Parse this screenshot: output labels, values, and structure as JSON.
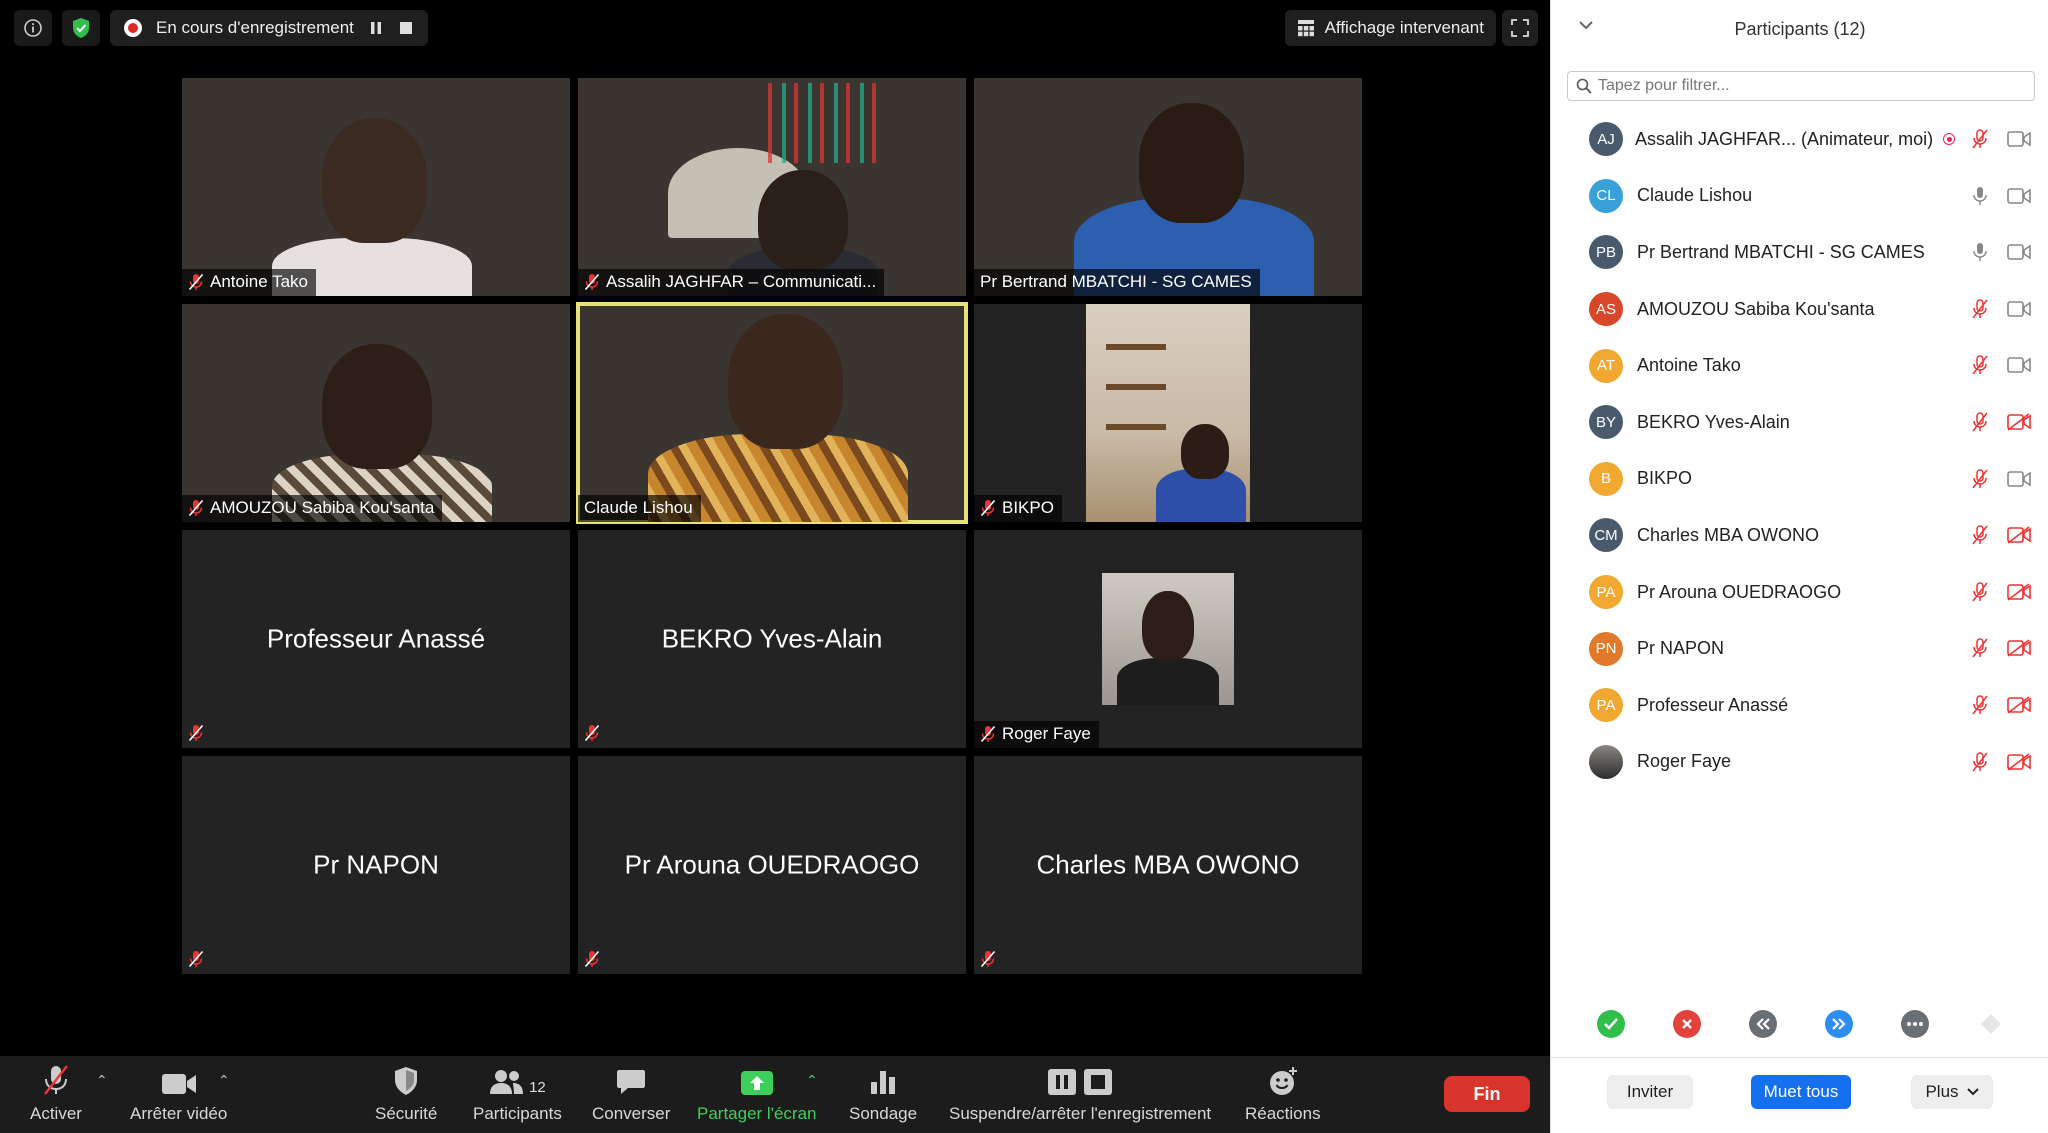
{
  "topbar": {
    "recording_label": "En cours d'enregistrement",
    "view_label": "Affichage intervenant"
  },
  "tiles": [
    {
      "name": "Antoine Tako",
      "type": "video",
      "muted": true
    },
    {
      "name": "Assalih JAGHFAR – Communicati...",
      "type": "video",
      "muted": true
    },
    {
      "name": "Pr Bertrand MBATCHI - SG CAMES",
      "type": "video",
      "muted": false
    },
    {
      "name": "AMOUZOU Sabiba Kou'santa",
      "type": "video",
      "muted": true
    },
    {
      "name": "Claude Lishou",
      "type": "video",
      "muted": false,
      "active": true
    },
    {
      "name": "BIKPO",
      "type": "video",
      "muted": true
    },
    {
      "name": "Professeur Anassé",
      "type": "name",
      "muted": true
    },
    {
      "name": "BEKRO Yves-Alain",
      "type": "name",
      "muted": true
    },
    {
      "name": "Roger Faye",
      "type": "photo",
      "muted": true
    },
    {
      "name": "Pr NAPON",
      "type": "name",
      "muted": true
    },
    {
      "name": "Pr Arouna OUEDRAOGO",
      "type": "name",
      "muted": true
    },
    {
      "name": "Charles MBA OWONO",
      "type": "name",
      "muted": true
    }
  ],
  "toolbar": {
    "unmute": "Activer",
    "stop_video": "Arrêter vidéo",
    "security": "Sécurité",
    "participants": "Participants",
    "participants_count": "12",
    "chat": "Converser",
    "share": "Partager l'écran",
    "poll": "Sondage",
    "recording": "Suspendre/arrêter l'enregistrement",
    "reactions": "Réactions",
    "end": "Fin"
  },
  "panel": {
    "title": "Participants (12)",
    "filter_placeholder": "Tapez pour filtrer...",
    "participants": [
      {
        "initials": "AJ",
        "name": "Assalih JAGHFAR... (Animateur, moi)",
        "color": "#4a5a6d",
        "mic": "off",
        "cam": "on",
        "host": true
      },
      {
        "initials": "CL",
        "name": "Claude Lishou",
        "color": "#3aa0d8",
        "mic": "on",
        "cam": "on"
      },
      {
        "initials": "PB",
        "name": "Pr Bertrand MBATCHI - SG CAMES",
        "color": "#4a5a6d",
        "mic": "on",
        "cam": "on"
      },
      {
        "initials": "AS",
        "name": "AMOUZOU Sabiba Kou'santa",
        "color": "#d9472b",
        "mic": "off",
        "cam": "on"
      },
      {
        "initials": "AT",
        "name": "Antoine Tako",
        "color": "#f0a830",
        "mic": "off",
        "cam": "on"
      },
      {
        "initials": "BY",
        "name": "BEKRO Yves-Alain",
        "color": "#4a5a6d",
        "mic": "off",
        "cam": "off"
      },
      {
        "initials": "B",
        "name": "BIKPO",
        "color": "#f0a830",
        "mic": "off",
        "cam": "on"
      },
      {
        "initials": "CM",
        "name": "Charles MBA OWONO",
        "color": "#4a5a6d",
        "mic": "off",
        "cam": "off"
      },
      {
        "initials": "PA",
        "name": "Pr Arouna OUEDRAOGO",
        "color": "#f0a830",
        "mic": "off",
        "cam": "off"
      },
      {
        "initials": "PN",
        "name": "Pr NAPON",
        "color": "#e07a2a",
        "mic": "off",
        "cam": "off"
      },
      {
        "initials": "PA",
        "name": "Professeur Anassé",
        "color": "#f0a830",
        "mic": "off",
        "cam": "off"
      },
      {
        "initials": "",
        "name": "Roger Faye",
        "color": "#2d2d2d",
        "mic": "off",
        "cam": "off",
        "photo": true
      }
    ],
    "invite": "Inviter",
    "mute_all": "Muet tous",
    "more": "Plus"
  }
}
